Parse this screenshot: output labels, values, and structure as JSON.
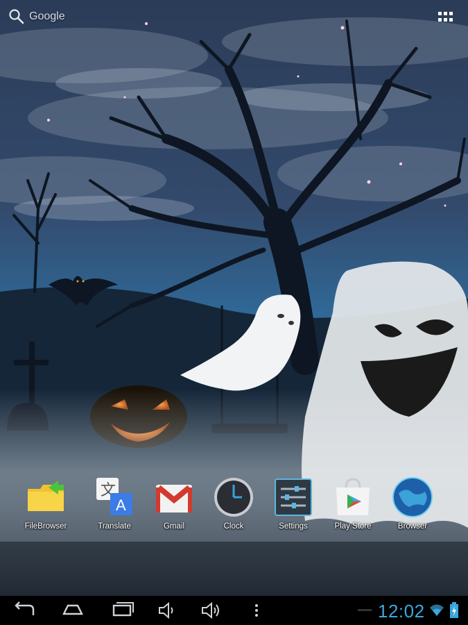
{
  "search": {
    "label": "Google",
    "icon": "search-icon"
  },
  "apps_button": {
    "icon": "all-apps-grid-icon"
  },
  "wallpaper": {
    "icon": "halloween-wallpaper"
  },
  "dock": {
    "apps": [
      {
        "label": "FileBrowser",
        "icon": "folder-icon"
      },
      {
        "label": "Translate",
        "icon": "translate-icon"
      },
      {
        "label": "Gmail",
        "icon": "gmail-icon"
      },
      {
        "label": "Clock",
        "icon": "clock-icon"
      },
      {
        "label": "Settings",
        "icon": "settings-icon"
      },
      {
        "label": "Play Store",
        "icon": "play-store-icon"
      },
      {
        "label": "Browser",
        "icon": "browser-globe-icon"
      }
    ]
  },
  "status_bar": {
    "time": "12:02",
    "time_color": "#3aa7de"
  },
  "nav": {
    "back": "back-icon",
    "home": "home-icon",
    "recents": "recents-icon",
    "volume_down": "volume-down-icon",
    "volume_up": "volume-up-icon",
    "menu": "menu-icon"
  }
}
